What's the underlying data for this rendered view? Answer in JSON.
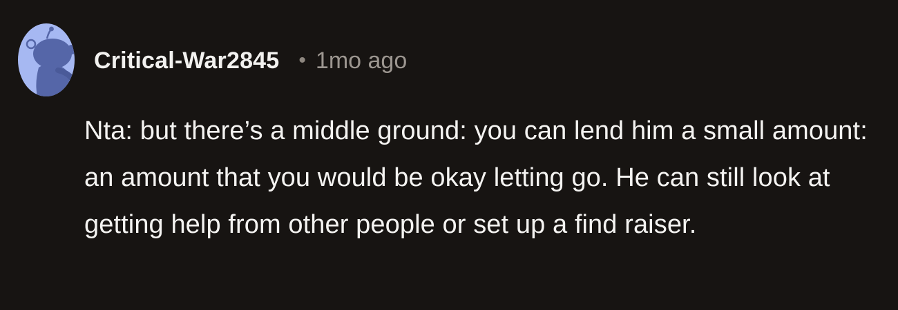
{
  "comment": {
    "username": "Critical-War2845",
    "separator": "•",
    "timestamp": "1mo ago",
    "text": "Nta: but there’s a middle ground: you can lend him a small amount: an amount that you would be okay letting go. He can still look at getting help from other people or set up a find raiser."
  },
  "colors": {
    "background": "#171412",
    "avatar_bg": "#a6b8f2",
    "avatar_figure": "#5566a8",
    "username": "#f2f1ef",
    "timestamp": "#9c9690",
    "body_text": "#f4f3f1"
  },
  "icons": {
    "avatar": "default-snoo-avatar-icon"
  }
}
